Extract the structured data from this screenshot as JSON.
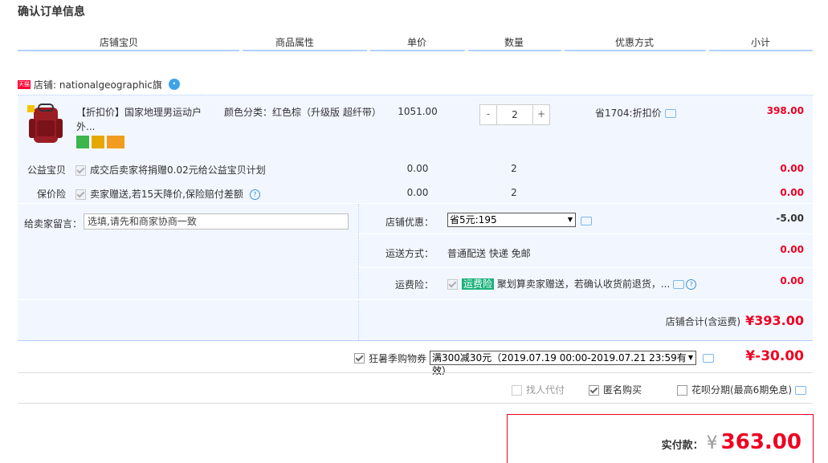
{
  "page_title": "确认订单信息",
  "columns": [
    "店铺宝贝",
    "商品属性",
    "单价",
    "数量",
    "优惠方式",
    "小计"
  ],
  "shop": {
    "tag": "天猫",
    "label": "店铺: nationalgeographic旗"
  },
  "product": {
    "name": "【折扣价】国家地理男运动户外...",
    "attr": "颜色分类：红色棕（升级版 超纤带）",
    "price": "1051.00",
    "qty": "2",
    "minus": "-",
    "plus": "+",
    "discount": "省1704:折扣价",
    "subtotal": "398.00"
  },
  "services": [
    {
      "label": "公益宝贝",
      "text": "成交后卖家将捐赠0.02元给公益宝贝计划",
      "price": "0.00",
      "qty": "2",
      "subtotal": "0.00"
    },
    {
      "label": "保价险",
      "text": "卖家赠送,若15天降价,保险赔付差额",
      "price": "0.00",
      "qty": "2",
      "subtotal": "0.00"
    }
  ],
  "message": {
    "label": "给卖家留言：",
    "placeholder": "选填,请先和商家协商一致"
  },
  "shop_discount": {
    "label": "店铺优惠：",
    "value": "省5元:195",
    "amount": "-5.00"
  },
  "shipping": {
    "label": "运送方式：",
    "value": "普通配送 快递 免邮",
    "amount": "0.00"
  },
  "freight_ins": {
    "label": "运费险：",
    "badge": "运费险",
    "text": "聚划算卖家赠送，若确认收货前退货，...",
    "amount": "0.00"
  },
  "shop_total": {
    "label": "店铺合计(含运费)",
    "value": "¥393.00"
  },
  "coupon": {
    "label": "狂暑季购物券",
    "value": "满300减30元（2019.07.19 00:00-2019.07.21 23:59有效）",
    "amount": "¥-30.00"
  },
  "options": {
    "proxy": "找人代付",
    "anonymous": "匿名购买",
    "huabei": "花呗分期(最高6期免息)"
  },
  "payment": {
    "label": "实付款：",
    "currency": "¥",
    "amount": "363.00"
  },
  "colors": {
    "accent": "#e02",
    "light_bg": "#f2f7ff",
    "header_line": "#b2d1ff"
  }
}
